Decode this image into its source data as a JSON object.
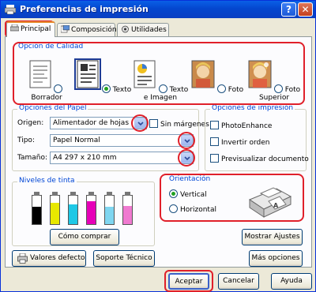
{
  "window": {
    "title": "Preferencias de impresión",
    "help_glyph": "?",
    "close_glyph": "✕"
  },
  "tabs": [
    {
      "label": "Principal",
      "active": true
    },
    {
      "label": "Composición",
      "active": false
    },
    {
      "label": "Utilidades",
      "active": false
    }
  ],
  "quality": {
    "title": "Opción de Calidad",
    "options": [
      {
        "label": "Borrador",
        "selected": false
      },
      {
        "label": "Texto",
        "selected": true
      },
      {
        "label": "Texto e Imagen",
        "selected": false
      },
      {
        "label": "Foto",
        "selected": false
      },
      {
        "label": "Foto Superior",
        "selected": false
      }
    ]
  },
  "paper": {
    "title": "Opciones del Papel",
    "origin_label": "Origen:",
    "origin_value": "Alimentador de hojas",
    "borderless_label": "Sin márgenes",
    "type_label": "Tipo:",
    "type_value": "Papel Normal",
    "size_label": "Tamaño:",
    "size_value": "A4 297 x 210 mm"
  },
  "print_options": {
    "title": "Opciones de impresión",
    "items": [
      {
        "label": "PhotoEnhance",
        "checked": false
      },
      {
        "label": "Invertir orden",
        "checked": false
      },
      {
        "label": "Previsualizar documento",
        "checked": false
      }
    ]
  },
  "ink": {
    "title": "Niveles de tinta",
    "cartridges": [
      {
        "color": "#000000",
        "level": 0.6
      },
      {
        "color": "#e8e800",
        "level": 0.75
      },
      {
        "color": "#1ec8e6",
        "level": 0.7
      },
      {
        "color": "#e600b8",
        "level": 0.8
      },
      {
        "color": "#7fd6f0",
        "level": 0.6
      },
      {
        "color": "#f07ad0",
        "level": 0.65
      }
    ],
    "buy_button": "Cómo comprar"
  },
  "orientation": {
    "title": "Orientación",
    "options": [
      {
        "label": "Vertical",
        "selected": true
      },
      {
        "label": "Horizontal",
        "selected": false
      }
    ]
  },
  "buttons": {
    "show_settings": "Mostrar Ajustes",
    "defaults": "Valores defecto",
    "tech_support": "Soporte Técnico",
    "more_options": "Más opciones",
    "accept": "Aceptar",
    "cancel": "Cancelar",
    "help": "Ayuda"
  },
  "colors": {
    "accent_red": "#e0202a",
    "group_title_blue": "#0046d5",
    "titlebar_blue": "#0a5fe6"
  }
}
